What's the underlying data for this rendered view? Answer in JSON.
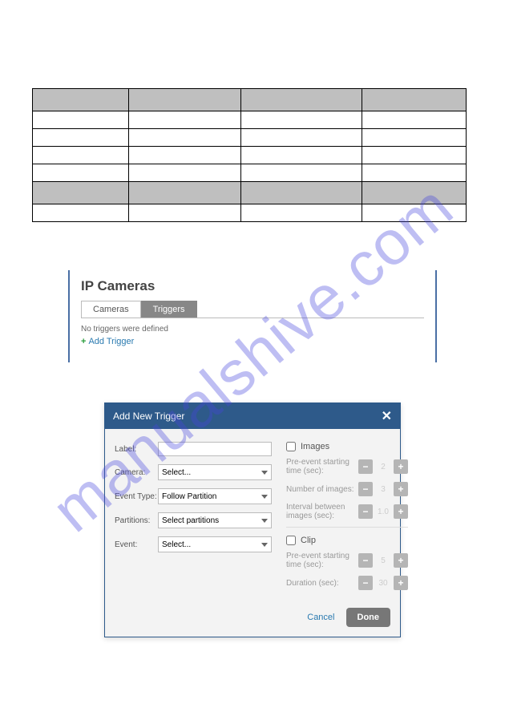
{
  "watermark": "manualshive.com",
  "ipcam": {
    "title": "IP Cameras",
    "tabs": {
      "cameras": "Cameras",
      "triggers": "Triggers"
    },
    "empty": "No triggers were defined",
    "add": "Add Trigger"
  },
  "modal": {
    "title": "Add New Trigger",
    "left": {
      "label": "Label:",
      "camera": "Camera:",
      "camera_sel": "Select...",
      "event_type": "Event Type:",
      "event_type_sel": "Follow Partition",
      "partitions": "Partitions:",
      "partitions_sel": "Select partitions",
      "event": "Event:",
      "event_sel": "Select..."
    },
    "right": {
      "images": "Images",
      "pre_event": "Pre-event starting time (sec):",
      "pre_event_val": "2",
      "num_images": "Number of images:",
      "num_images_val": "3",
      "interval": "Interval between images (sec):",
      "interval_val": "1.0",
      "clip": "Clip",
      "pre_event2": "Pre-event starting time (sec):",
      "pre_event2_val": "5",
      "duration": "Duration (sec):",
      "duration_val": "30"
    },
    "cancel": "Cancel",
    "done": "Done"
  }
}
